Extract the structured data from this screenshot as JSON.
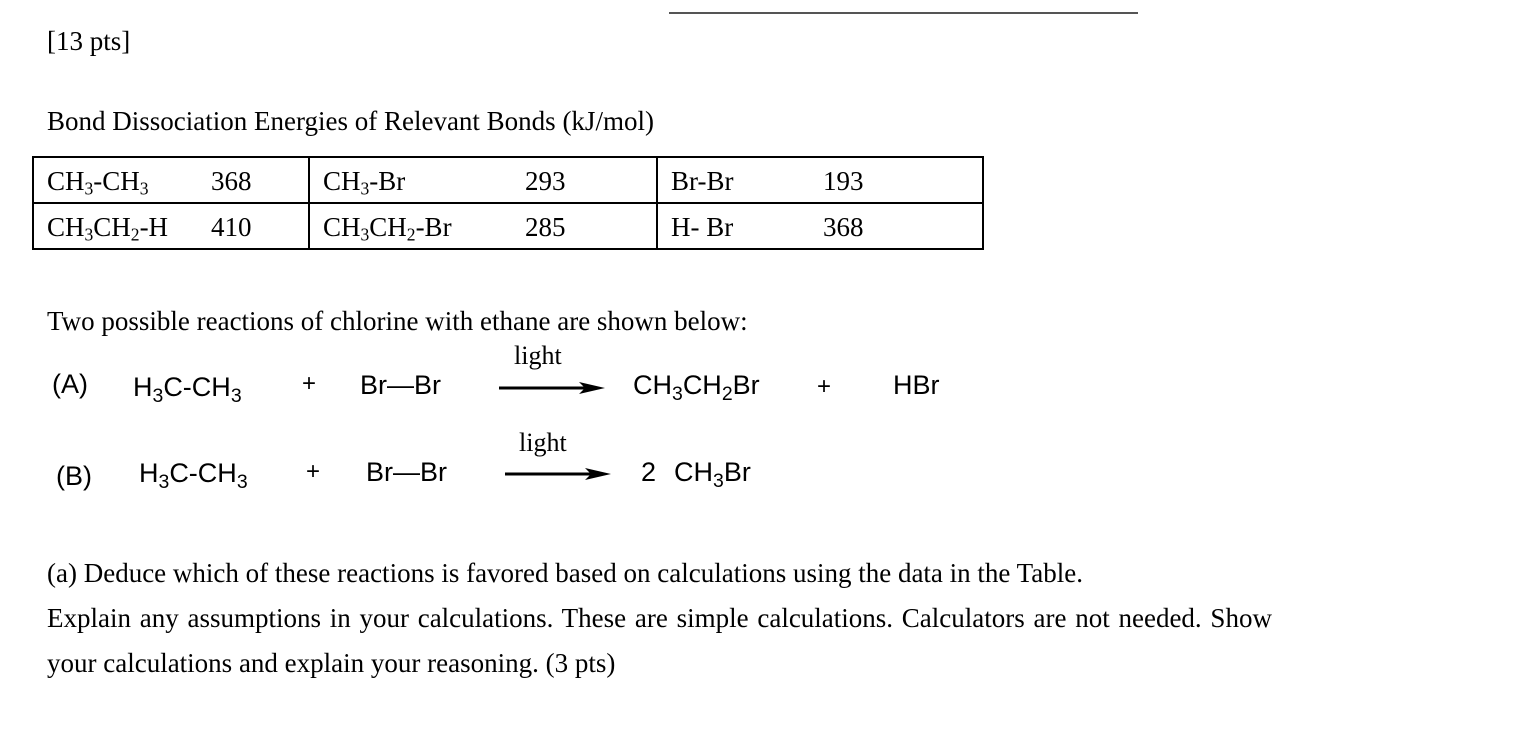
{
  "header": {
    "points": "[13 pts]"
  },
  "table": {
    "title": "Bond Dissociation Energies of Relevant Bonds (kJ/mol)",
    "rows": [
      [
        {
          "bond_parts": [
            "CH",
            "3",
            "-CH",
            "3"
          ],
          "value": "368"
        },
        {
          "bond_parts": [
            "CH",
            "3",
            "-Br"
          ],
          "value": "293"
        },
        {
          "bond_parts": [
            "Br-Br"
          ],
          "value": "193"
        }
      ],
      [
        {
          "bond_parts": [
            "CH",
            "3",
            "CH",
            "2",
            "-H"
          ],
          "value": "410"
        },
        {
          "bond_parts": [
            "CH",
            "3",
            "CH",
            "2",
            "-Br"
          ],
          "value": "285"
        },
        {
          "bond_parts": [
            "H- Br"
          ],
          "value": "368"
        }
      ]
    ]
  },
  "reactions": {
    "intro": "Two possible reactions of chlorine with ethane are shown below:",
    "condition": "light",
    "A": {
      "label": "(A)",
      "reactant1": [
        "H",
        "3",
        "C-CH",
        "3"
      ],
      "plus": "+",
      "reactant2": "Br—Br",
      "product1": [
        "CH",
        "3",
        "CH",
        "2",
        "Br"
      ],
      "product2": "HBr"
    },
    "B": {
      "label": "(B)",
      "reactant1": [
        "H",
        "3",
        "C-CH",
        "3"
      ],
      "plus": "+",
      "reactant2": "Br—Br",
      "coefficient": "2",
      "product1": [
        "CH",
        "3",
        "Br"
      ]
    }
  },
  "question": {
    "line1": "(a) Deduce which of these reactions is favored based on calculations using the data in the Table.",
    "line2": "Explain any assumptions in your calculations. These are simple calculations. Calculators are not needed. Show",
    "line3": "your calculations and explain your reasoning. (3 pts)"
  }
}
